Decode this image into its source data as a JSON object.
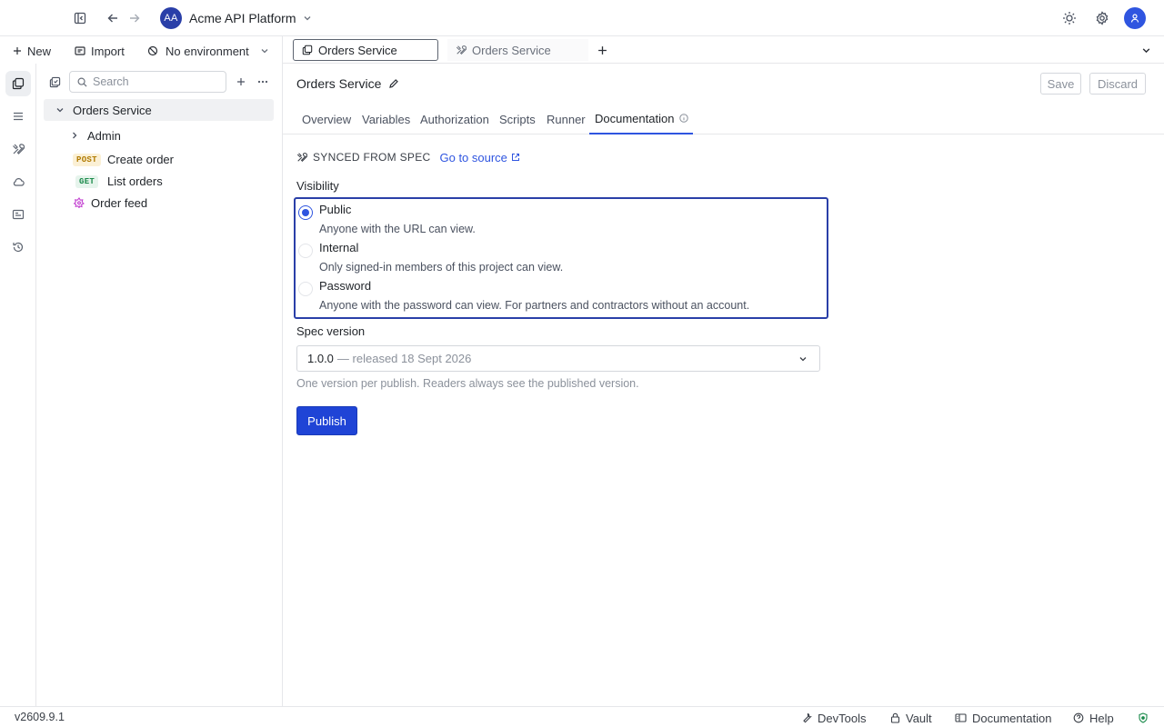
{
  "topbar": {
    "workspace_initials": "AA",
    "workspace_name": "Acme API Platform"
  },
  "sidebar": {
    "new_label": "New",
    "import_label": "Import",
    "environment_label": "No environment",
    "search_placeholder": "Search",
    "tree": {
      "root": "Orders Service",
      "items": [
        {
          "label": "Admin",
          "type": "folder"
        },
        {
          "label": "Create order",
          "method": "POST"
        },
        {
          "label": "List orders",
          "method": "GET"
        },
        {
          "label": "Order feed",
          "type": "feed"
        }
      ]
    }
  },
  "tabs": [
    {
      "label": "Orders Service"
    },
    {
      "label": "Orders Service"
    }
  ],
  "main": {
    "title": "Orders Service",
    "save_label": "Save",
    "discard_label": "Discard",
    "subtabs": [
      "Overview",
      "Variables",
      "Authorization",
      "Scripts",
      "Runner",
      "Documentation"
    ],
    "synced_label": "SYNCED FROM SPEC",
    "go_to_source": "Go to source",
    "visibility_label": "Visibility",
    "visibility_options": [
      {
        "title": "Public",
        "desc": "Anyone with the URL can view.",
        "checked": true
      },
      {
        "title": "Internal",
        "desc": "Only signed-in members of this project can view.",
        "checked": false
      },
      {
        "title": "Password",
        "desc": "Anyone with the password can view. For partners and contractors without an account.",
        "checked": false
      }
    ],
    "spec_version_label": "Spec version",
    "spec_version_value": "1.0.0",
    "spec_version_meta": "— released 18 Sept 2026",
    "spec_hint": "One version per publish. Readers always see the published version.",
    "publish_label": "Publish"
  },
  "statusbar": {
    "version": "v2609.9.1",
    "devtools": "DevTools",
    "vault": "Vault",
    "documentation": "Documentation",
    "help": "Help"
  },
  "colors": {
    "accent": "#2f55e0",
    "primary_button": "#1f44d6",
    "focus_border": "#2a3fa8",
    "post_badge": "#b07a00",
    "get_badge": "#1a8a4a",
    "feed_icon": "#c23fd0"
  }
}
